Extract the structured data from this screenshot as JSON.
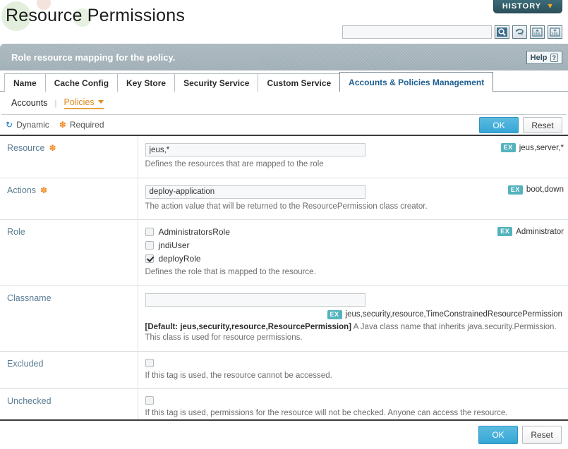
{
  "header": {
    "title": "Resource Permissions",
    "history_button": "HISTORY",
    "history_caret": "chevron-down-icon",
    "search_placeholder": "",
    "search_value": "",
    "tools": [
      {
        "name": "search-icon",
        "title": "Search"
      },
      {
        "name": "refresh-icon",
        "title": "Refresh"
      },
      {
        "name": "xml-import-icon",
        "title": "Import XML"
      },
      {
        "name": "xml-export-icon",
        "title": "Export XML"
      }
    ]
  },
  "description_bar": {
    "text": "Role resource mapping for the policy.",
    "help_label": "Help",
    "help_mark": "?"
  },
  "tabs": [
    {
      "label": "Name",
      "active": false
    },
    {
      "label": "Cache Config",
      "active": false
    },
    {
      "label": "Key Store",
      "active": false
    },
    {
      "label": "Security Service",
      "active": false
    },
    {
      "label": "Custom Service",
      "active": false
    },
    {
      "label": "Accounts & Policies Management",
      "active": true
    }
  ],
  "subnav": {
    "items": [
      {
        "label": "Accounts",
        "current": false
      },
      {
        "label": "Policies",
        "current": true
      }
    ],
    "separator": "|"
  },
  "legend": {
    "dynamic_label": "Dynamic",
    "dynamic_icon": "dynamic-refresh-icon",
    "required_label": "Required",
    "required_icon": "required-asterisk-icon"
  },
  "actions": {
    "ok_label": "OK",
    "reset_label": "Reset"
  },
  "colors": {
    "accent_blue": "#36a6d6",
    "label_blue": "#5a7c93",
    "required_orange": "#f08a24",
    "ex_badge_teal": "#54b3bd",
    "history_teal": "#2c505c",
    "policies_orange": "#e08a1e"
  },
  "fields": [
    {
      "label": "Resource",
      "required": true,
      "value": "jeus,*",
      "placeholder": "",
      "hint": "Defines the resources that are mapped to the role",
      "example_badge": "EX",
      "example": "jeus,server,*"
    },
    {
      "label": "Actions",
      "required": true,
      "value": "deploy-application",
      "placeholder": "",
      "hint": "The action value that will be returned to the ResourcePermission class creator.",
      "example_badge": "EX",
      "example": "boot,down"
    },
    {
      "label": "Role",
      "required": false,
      "hint": "Defines the role that is mapped to the resource.",
      "example_badge": "EX",
      "example": "Administrator",
      "checkboxes": [
        {
          "label": "AdministratorsRole",
          "checked": false
        },
        {
          "label": "jndiUser",
          "checked": false
        },
        {
          "label": "deployRole",
          "checked": true
        }
      ]
    },
    {
      "label": "Classname",
      "required": false,
      "value": "",
      "placeholder": "",
      "default_tag": "[Default: jeus,security,resource,ResourcePermission]",
      "hint": "A Java class name that inherits java.security.Permission. This class is used for resource permissions.",
      "example_badge": "EX",
      "example": "jeus,security,resource,TimeConstrainedResourcePermission"
    },
    {
      "label": "Excluded",
      "required": false,
      "hint": "If this tag is used, the resource cannot be accessed.",
      "checkboxes": [
        {
          "label": "",
          "checked": false
        }
      ]
    },
    {
      "label": "Unchecked",
      "required": false,
      "hint": "If this tag is used, permissions for the resource will not be checked. Anyone can access the resource.",
      "checkboxes": [
        {
          "label": "",
          "checked": false
        }
      ]
    }
  ]
}
